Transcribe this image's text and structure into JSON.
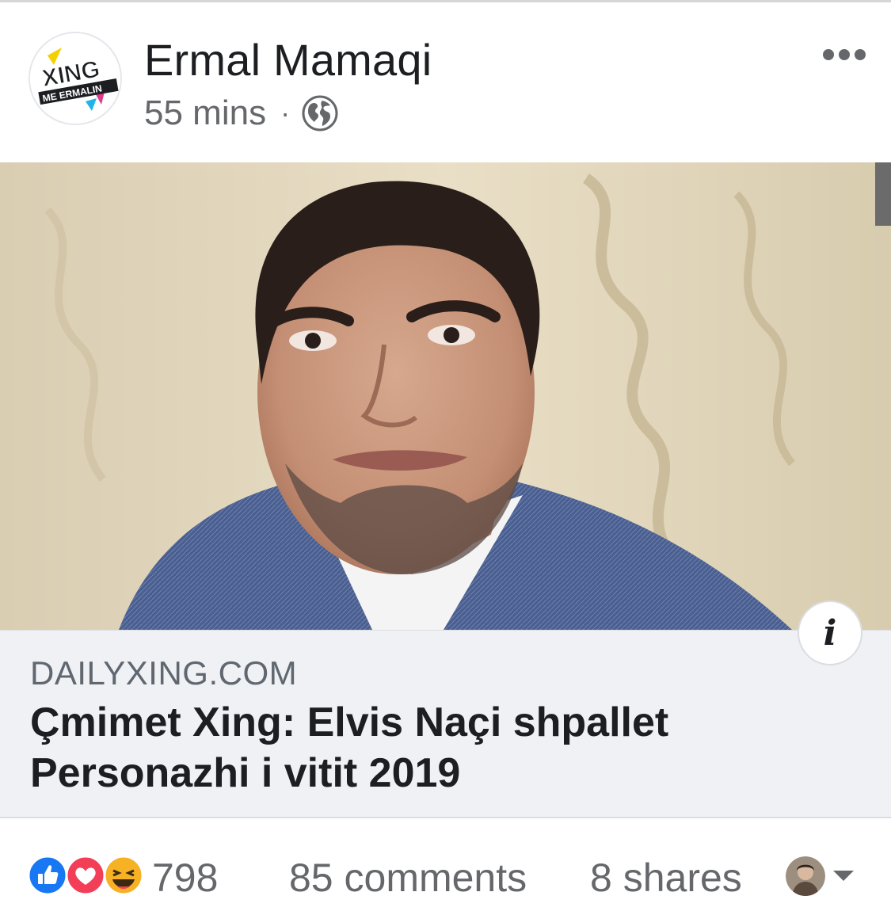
{
  "post": {
    "author": "Ermal Mamaqi",
    "time": "55 mins",
    "separator": "·",
    "privacy_icon": "globe-icon",
    "more_icon": "more-options-icon",
    "avatar": {
      "logo_text": "XING",
      "logo_subtext": "ME ERMALIN"
    }
  },
  "link_preview": {
    "domain": "DAILYXING.COM",
    "headline": "Çmimet Xing: Elvis Naçi shpallet Personazhi i vitit 2019",
    "info_label": "i"
  },
  "footer": {
    "reaction_icons": [
      "like-icon",
      "love-icon",
      "haha-icon"
    ],
    "reaction_count": "798",
    "comments": "85 comments",
    "shares": "8 shares"
  },
  "colors": {
    "like_blue": "#1877f2",
    "love_red": "#f33e58",
    "haha_yellow": "#f7b125",
    "card_bg": "#eff1f4"
  }
}
